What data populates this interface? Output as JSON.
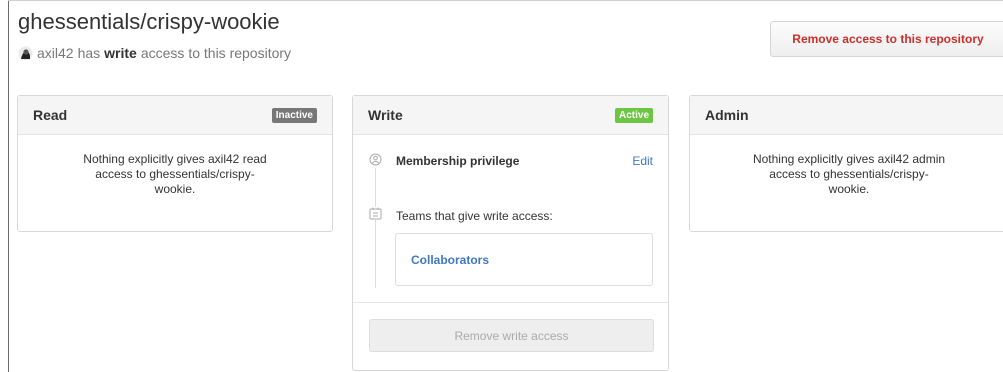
{
  "repo": {
    "title": "ghessentials/crispy-wookie",
    "user": "axil42",
    "has_text": "has",
    "permission": "write",
    "access_suffix": "access to this repository"
  },
  "actions": {
    "remove_repo_access": "Remove access to this repository"
  },
  "cards": {
    "read": {
      "title": "Read",
      "status": "Inactive",
      "message": "Nothing explicitly gives axil42 read access to ghessentials/crispy-wookie."
    },
    "write": {
      "title": "Write",
      "status": "Active",
      "privilege_label": "Membership privilege",
      "edit_label": "Edit",
      "teams_label": "Teams that give write access:",
      "team_name": "Collaborators",
      "remove_button": "Remove write access"
    },
    "admin": {
      "title": "Admin",
      "status": "",
      "message": "Nothing explicitly gives axil42 admin access to ghessentials/crispy-wookie."
    }
  },
  "colors": {
    "badge_inactive": "#777777",
    "badge_active": "#6cc644",
    "link": "#4078c0",
    "danger": "#c9302c"
  },
  "icons": {
    "avatar": "user-avatar",
    "privilege": "org-membership-icon",
    "teams": "team-icon"
  }
}
